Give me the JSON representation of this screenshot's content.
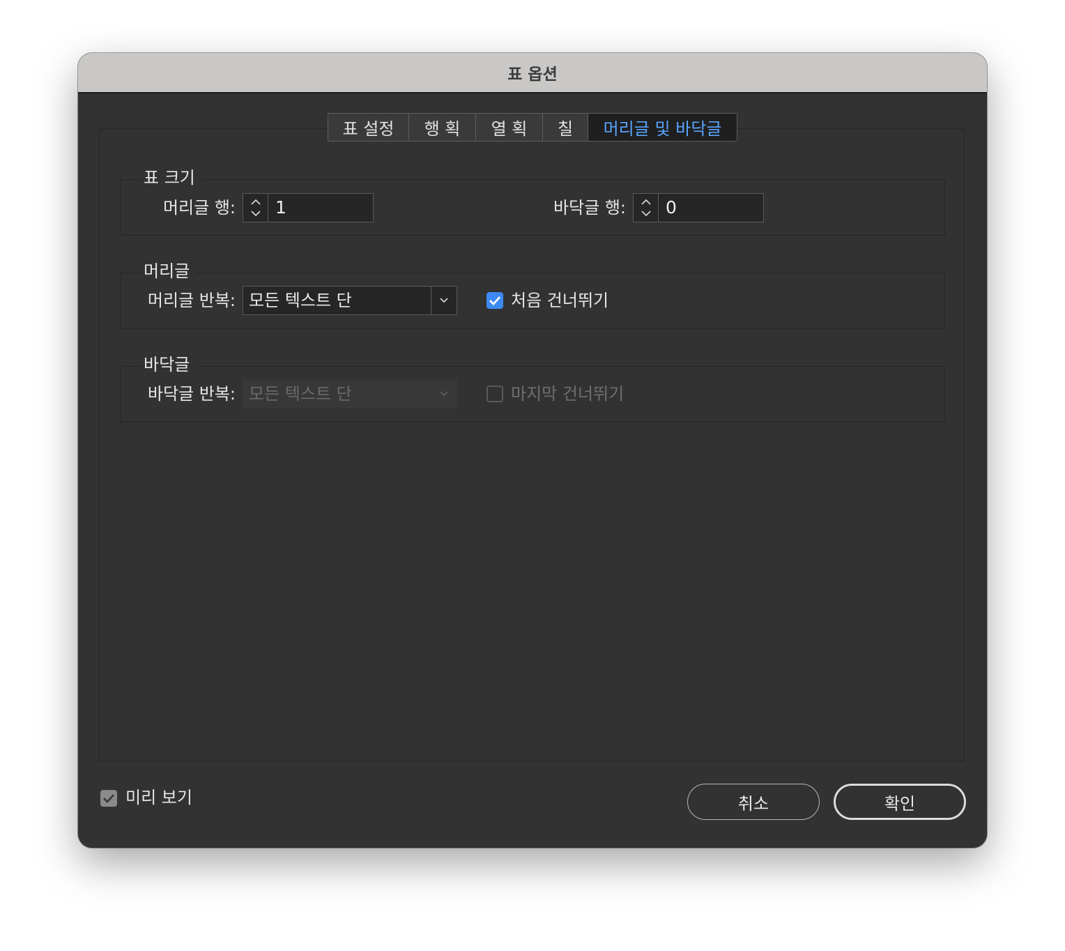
{
  "window": {
    "title": "표 옵션"
  },
  "tabs": [
    {
      "label": "표 설정"
    },
    {
      "label": "행 획"
    },
    {
      "label": "열 획"
    },
    {
      "label": "칠"
    },
    {
      "label": "머리글 및 바닥글"
    }
  ],
  "active_tab": "머리글 및 바닥글",
  "table_size": {
    "legend": "표 크기",
    "header_rows_label": "머리글 행:",
    "header_rows_value": "1",
    "footer_rows_label": "바닥글 행:",
    "footer_rows_value": "0"
  },
  "header": {
    "legend": "머리글",
    "repeat_label": "머리글 반복:",
    "repeat_value": "모든 텍스트 단",
    "skip_first_label": "처음 건너뛰기",
    "skip_first_checked": true
  },
  "footer": {
    "legend": "바닥글",
    "repeat_label": "바닥글 반복:",
    "repeat_value": "모든 텍스트 단",
    "skip_last_label": "마지막 건너뛰기",
    "skip_last_checked": false
  },
  "footer_bar": {
    "preview_label": "미리 보기",
    "preview_checked": true,
    "cancel_label": "취소",
    "ok_label": "확인"
  },
  "colors": {
    "accent": "#58a4ff",
    "checkbox_accent": "#3d8bf2",
    "window_bg": "#323232",
    "titlebar_bg": "#c9c8c6"
  }
}
